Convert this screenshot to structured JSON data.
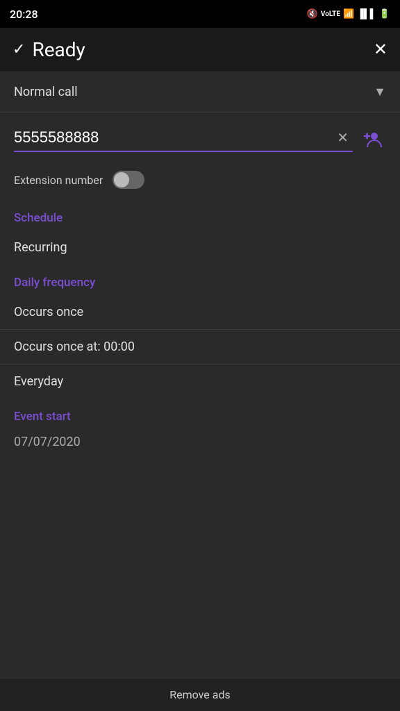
{
  "statusBar": {
    "time": "20:28"
  },
  "header": {
    "checkmark": "✓",
    "title": "Ready",
    "closeIcon": "✕"
  },
  "callType": {
    "label": "Normal call",
    "dropdownIcon": "▼"
  },
  "phoneInput": {
    "value": "5555588888",
    "clearIcon": "✕"
  },
  "extension": {
    "label": "Extension number"
  },
  "schedule": {
    "sectionLabel": "Schedule",
    "recurring": "Recurring"
  },
  "dailyFrequency": {
    "sectionLabel": "Daily frequency",
    "occursOnce": "Occurs once",
    "occursOnceAt": "Occurs once at: 00:00"
  },
  "recurrence": {
    "everyday": "Everyday"
  },
  "eventStart": {
    "sectionLabel": "Event start",
    "date": "07/07/2020"
  },
  "footer": {
    "removeAds": "Remove ads"
  }
}
